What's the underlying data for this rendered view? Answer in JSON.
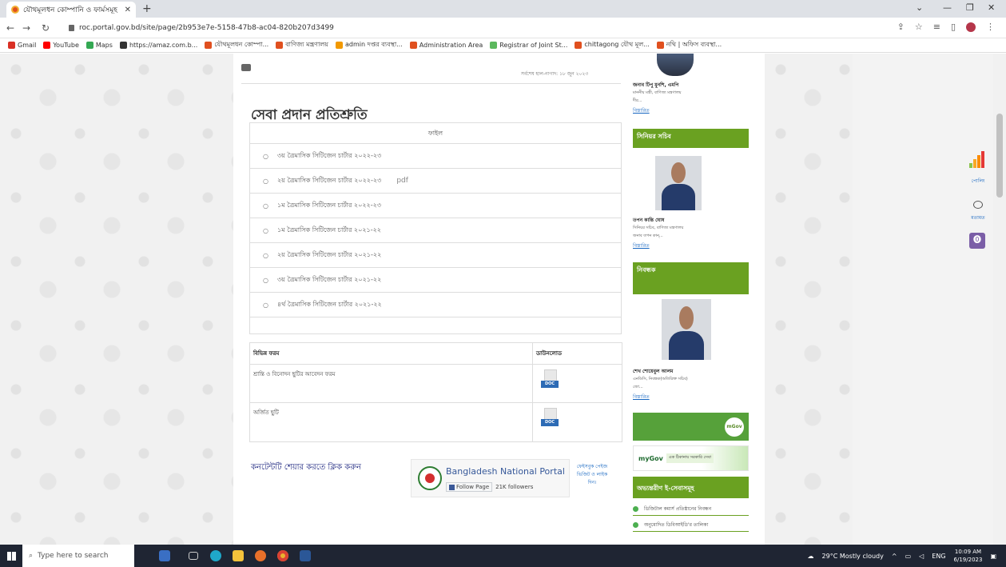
{
  "browser": {
    "tab_title": "যৌথমূলধন কোম্পানি ও ফার্মসমূহ",
    "url": "roc.portal.gov.bd/site/page/2b953e7e-5158-47b8-ac04-820b207d3499",
    "bookmarks": [
      {
        "label": "Gmail",
        "color": "#d93025"
      },
      {
        "label": "YouTube",
        "color": "#ff0000"
      },
      {
        "label": "Maps",
        "color": "#34a853"
      },
      {
        "label": "https://amaz.com.b...",
        "color": "#333333"
      },
      {
        "label": "যৌথমূলধন কোম্পা...",
        "color": "#e0501f"
      },
      {
        "label": "বাণিজ্য মন্ত্রণালয়",
        "color": "#e0501f"
      },
      {
        "label": "admin দপ্তর ব্যবস্থা...",
        "color": "#f29900"
      },
      {
        "label": "Administration Area",
        "color": "#e0501f"
      },
      {
        "label": "Registrar of Joint St...",
        "color": "#5bb85d"
      },
      {
        "label": "chittagong যৌথ মূল...",
        "color": "#e0501f"
      },
      {
        "label": "নথি | অফিস ব্যবস্থা...",
        "color": "#e0501f"
      }
    ]
  },
  "page": {
    "updated_text": "সর্বশেষ হাল-নাগাদ: ১৮ জুন ২০২৩",
    "title": "সেবা প্রদান প্রতিশ্রুতি",
    "file_table": {
      "header": "ফাইল",
      "rows": [
        {
          "label": "৩য় ত্রৈমাসিক সিটিজেন চার্টার ২০২২-২৩",
          "suffix": ""
        },
        {
          "label": "২য় ত্রৈমাসিক সিটিজেন চার্টার ২০২২-২৩",
          "suffix": "pdf"
        },
        {
          "label": "১ম ত্রৈমাসিক সিটিজেন চার্টার ২০২২-২৩",
          "suffix": ""
        },
        {
          "label": "১ম ত্রৈমাসিক সিটিজেন চার্টার ২০২১-২২",
          "suffix": ""
        },
        {
          "label": "২য় ত্রৈমাসিক সিটিজেন চার্টার ২০২১-২২",
          "suffix": ""
        },
        {
          "label": "৩য় ত্রৈমাসিক সিটিজেন চার্টার ২০২১-২২",
          "suffix": ""
        },
        {
          "label": "৪র্থ ত্রৈমাসিক সিটিজেন চার্টার ২০২১-২২",
          "suffix": ""
        }
      ]
    },
    "form_table": {
      "col1": "বিভিন্ন ফরম",
      "col2": "ডাউনলোড",
      "rows": [
        {
          "label": "শ্রান্তি ও বিনোদন ছুটির আবেদন ফরম",
          "badge": "DOC"
        },
        {
          "label": "অর্জিত ছুটি",
          "badge": "DOC"
        }
      ]
    },
    "share_text": "কনটেন্টটি শেয়ার করতে ক্লিক করুন",
    "fb": {
      "name": "Bangladesh National Portal",
      "follow": "Follow Page",
      "followers": "21K followers",
      "side": "ফেইসবুক পেইজ ভিজিট ও লাইক দিন।"
    }
  },
  "sidebar": {
    "minister": {
      "name": "জনাব টিপু মুনশি, এমপি",
      "desc": "মাননীয় মন্ত্রী, বাণিজ্য মন্ত্রণালয়",
      "extra": "দীর...",
      "details": "বিস্তারিত"
    },
    "senior_secretary": {
      "heading": "সিনিয়র সচিব",
      "name": "তপন কান্তি ঘোষ",
      "desc": "সিনিয়র সচিব, বাণিজ্য মন্ত্রণালয়",
      "extra": "জনাব তপন কান্...",
      "details": "বিস্তারিত"
    },
    "registrar": {
      "heading": "নিবন্ধক",
      "name": "শেখ শোয়েবুল আলম",
      "desc": "এনডিসি, নিবন্ধক(অতিরিক্ত সচিব)",
      "extra": "জো...",
      "details": "বিস্তারিত"
    },
    "mgov_badge": "mGov",
    "mygov": {
      "logo": "myGov",
      "tag": "এক ঠিকানায় সরকারি সেবা"
    },
    "eservices": {
      "heading": "অভ্যন্তরীণ ই-সেবাসমূহ",
      "items": [
        "ডিজিটাল কমার্স প্রতিষ্ঠানের নিবন্ধন",
        "অনুমোদিত ডিবিআইডি'র তালিকা"
      ]
    }
  },
  "floating": {
    "poll_label": "পোলিং",
    "feedback_label": "মতামত",
    "poll_colors": [
      "#8bc34a",
      "#f9a825",
      "#fb8c00",
      "#e53935"
    ]
  },
  "taskbar": {
    "search_placeholder": "Type here to search",
    "weather": "29°C  Mostly cloudy",
    "lang": "ENG",
    "time": "10:09 AM",
    "date": "6/19/2023"
  }
}
